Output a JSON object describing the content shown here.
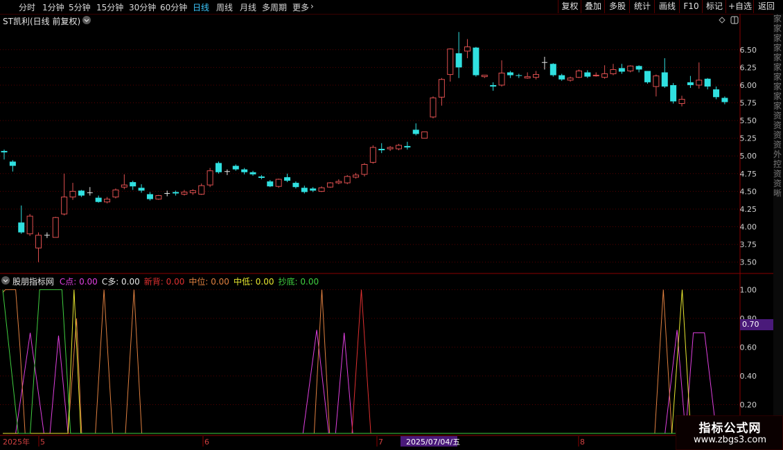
{
  "toolbar": {
    "tabs": [
      "分时",
      "1分钟",
      "5分钟",
      "15分钟",
      "30分钟",
      "60分钟",
      "日线",
      "周线",
      "月线",
      "多周期",
      "更多"
    ],
    "active_tab": "日线",
    "right_buttons": [
      "复权",
      "叠加",
      "多股",
      "统计",
      "画线",
      "F10",
      "标记",
      "+自选",
      "返回"
    ]
  },
  "stock": {
    "title": "ST凯利(日线 前复权)"
  },
  "indicator": {
    "name": "股朋指标网",
    "series": [
      {
        "label": "C点: 0.00",
        "color": "#e040e0"
      },
      {
        "label": "C多: 0.00",
        "color": "#e6e6e6"
      },
      {
        "label": "新背: 0.00",
        "color": "#e03030"
      },
      {
        "label": "中位: 0.00",
        "color": "#e08040"
      },
      {
        "label": "中低: 0.00",
        "color": "#e8e830"
      },
      {
        "label": "抄底: 0.00",
        "color": "#40d040"
      }
    ],
    "current_value": "0.70"
  },
  "right_strip_text": "家家家家家家家家家家资资资资外控资资晰",
  "watermark": {
    "main": "指标公式网",
    "sub": "www.zbgs3.com"
  },
  "date_axis": {
    "labels": [
      "2025年",
      "5",
      "6",
      "7",
      "2025/07/04/五",
      "8"
    ]
  },
  "chart_data": [
    {
      "type": "candlestick",
      "title": "ST凯利(日线 前复权)",
      "y_ticks": [
        3.5,
        3.75,
        4.0,
        4.25,
        4.5,
        4.75,
        5.0,
        5.25,
        5.5,
        5.75,
        6.0,
        6.25,
        6.5
      ],
      "ylim": [
        3.35,
        6.85
      ],
      "grid": true,
      "up_color": "#e05050",
      "down_color": "#30e0e0",
      "candles": [
        [
          5.07,
          5.05,
          4.95,
          5.09
        ],
        [
          4.92,
          4.86,
          4.78,
          4.94
        ],
        [
          4.06,
          3.92,
          3.9,
          4.3
        ],
        [
          3.9,
          4.15,
          3.87,
          4.18
        ],
        [
          3.7,
          3.88,
          3.5,
          3.92
        ],
        [
          3.88,
          3.88,
          3.84,
          3.92
        ],
        [
          3.85,
          4.13,
          3.85,
          4.14
        ],
        [
          4.18,
          4.42,
          4.16,
          4.75
        ],
        [
          4.42,
          4.5,
          4.38,
          4.62
        ],
        [
          4.51,
          4.44,
          4.42,
          4.52
        ],
        [
          4.48,
          4.48,
          4.44,
          4.56
        ],
        [
          4.41,
          4.35,
          4.34,
          4.44
        ],
        [
          4.35,
          4.39,
          4.33,
          4.42
        ],
        [
          4.42,
          4.52,
          4.4,
          4.54
        ],
        [
          4.56,
          4.59,
          4.53,
          4.74
        ],
        [
          4.63,
          4.57,
          4.52,
          4.65
        ],
        [
          4.55,
          4.51,
          4.48,
          4.6
        ],
        [
          4.46,
          4.39,
          4.37,
          4.49
        ],
        [
          4.39,
          4.44,
          4.38,
          4.45
        ],
        [
          4.47,
          4.47,
          4.43,
          4.51
        ],
        [
          4.49,
          4.47,
          4.44,
          4.51
        ],
        [
          4.46,
          4.49,
          4.44,
          4.52
        ],
        [
          4.48,
          4.51,
          4.45,
          4.53
        ],
        [
          4.46,
          4.58,
          4.45,
          4.61
        ],
        [
          4.59,
          4.79,
          4.56,
          4.83
        ],
        [
          4.9,
          4.77,
          4.75,
          4.92
        ],
        [
          4.78,
          4.78,
          4.73,
          4.81
        ],
        [
          4.86,
          4.81,
          4.79,
          4.88
        ],
        [
          4.81,
          4.77,
          4.74,
          4.83
        ],
        [
          4.77,
          4.74,
          4.72,
          4.79
        ],
        [
          4.71,
          4.69,
          4.67,
          4.73
        ],
        [
          4.64,
          4.57,
          4.56,
          4.66
        ],
        [
          4.57,
          4.67,
          4.55,
          4.68
        ],
        [
          4.7,
          4.65,
          4.63,
          4.75
        ],
        [
          4.62,
          4.56,
          4.54,
          4.64
        ],
        [
          4.55,
          4.49,
          4.47,
          4.58
        ],
        [
          4.54,
          4.51,
          4.49,
          4.56
        ],
        [
          4.5,
          4.55,
          4.49,
          4.57
        ],
        [
          4.56,
          4.62,
          4.55,
          4.63
        ],
        [
          4.62,
          4.64,
          4.6,
          4.67
        ],
        [
          4.62,
          4.71,
          4.6,
          4.73
        ],
        [
          4.7,
          4.73,
          4.68,
          4.76
        ],
        [
          4.74,
          4.88,
          4.71,
          4.9
        ],
        [
          4.91,
          5.12,
          4.89,
          5.15
        ],
        [
          5.1,
          5.08,
          5.04,
          5.18
        ],
        [
          5.1,
          5.12,
          5.07,
          5.14
        ],
        [
          5.1,
          5.15,
          5.08,
          5.17
        ],
        [
          5.14,
          5.12,
          5.09,
          5.2
        ],
        [
          5.37,
          5.31,
          5.29,
          5.46
        ],
        [
          5.25,
          5.34,
          5.25,
          5.34
        ],
        [
          5.55,
          5.82,
          5.53,
          5.84
        ],
        [
          5.83,
          6.08,
          5.71,
          6.1
        ],
        [
          6.15,
          6.51,
          6.05,
          6.52
        ],
        [
          6.45,
          6.25,
          6.1,
          6.75
        ],
        [
          6.48,
          6.54,
          6.38,
          6.65
        ],
        [
          6.53,
          6.14,
          6.12,
          6.54
        ],
        [
          6.12,
          6.14,
          6.1,
          6.14
        ],
        [
          6.0,
          5.98,
          5.92,
          6.04
        ],
        [
          6.0,
          6.17,
          5.98,
          6.35
        ],
        [
          6.18,
          6.14,
          6.1,
          6.2
        ],
        [
          6.14,
          6.13,
          6.1,
          6.16
        ],
        [
          6.1,
          6.12,
          6.09,
          6.18
        ],
        [
          6.11,
          6.15,
          6.08,
          6.2
        ],
        [
          6.32,
          6.32,
          6.22,
          6.4
        ],
        [
          6.3,
          6.14,
          6.12,
          6.31
        ],
        [
          6.14,
          6.08,
          6.06,
          6.16
        ],
        [
          6.07,
          6.1,
          6.05,
          6.12
        ],
        [
          6.11,
          6.2,
          6.1,
          6.22
        ],
        [
          6.18,
          6.12,
          6.1,
          6.21
        ],
        [
          6.13,
          6.14,
          6.12,
          6.18
        ],
        [
          6.11,
          6.16,
          6.09,
          6.28
        ],
        [
          6.16,
          6.22,
          6.14,
          6.3
        ],
        [
          6.24,
          6.19,
          6.16,
          6.3
        ],
        [
          6.2,
          6.27,
          6.18,
          6.28
        ],
        [
          6.27,
          6.22,
          6.18,
          6.28
        ],
        [
          6.2,
          6.04,
          6.02,
          6.2
        ],
        [
          5.98,
          6.13,
          5.84,
          6.15
        ],
        [
          6.18,
          5.98,
          5.96,
          6.38
        ],
        [
          6.0,
          5.77,
          5.74,
          6.03
        ],
        [
          5.74,
          5.8,
          5.7,
          5.85
        ],
        [
          6.04,
          6.0,
          5.96,
          6.13
        ],
        [
          6.0,
          6.07,
          5.95,
          6.32
        ],
        [
          6.09,
          5.98,
          5.94,
          6.1
        ],
        [
          5.94,
          5.83,
          5.8,
          5.98
        ],
        [
          5.82,
          5.76,
          5.73,
          5.84
        ]
      ]
    },
    {
      "type": "line",
      "title": "股朋指标网",
      "y_ticks": [
        0.2,
        0.4,
        0.6,
        0.8,
        1.0
      ],
      "ylim": [
        0.0,
        1.05
      ],
      "series": [
        {
          "name": "C点",
          "color": "#e040e0",
          "points": [
            [
              0,
              0
            ],
            [
              1.5,
              0
            ],
            [
              3.2,
              0.7
            ],
            [
              4.8,
              0
            ],
            [
              5.5,
              0
            ],
            [
              6.5,
              0.68
            ],
            [
              7.6,
              0
            ],
            [
              35.0,
              0
            ],
            [
              36.6,
              0.72
            ],
            [
              38.0,
              0
            ],
            [
              38.8,
              0
            ],
            [
              39.8,
              0.7
            ],
            [
              40.8,
              0
            ],
            [
              77.2,
              0
            ],
            [
              78.6,
              0.72
            ],
            [
              79.6,
              0
            ],
            [
              80.5,
              0.7
            ],
            [
              81.8,
              0.7
            ],
            [
              83.2,
              0
            ],
            [
              86,
              0
            ]
          ]
        },
        {
          "name": "新背",
          "color": "#e03030",
          "points": [
            [
              0,
              0
            ],
            [
              40.7,
              0
            ],
            [
              41.8,
              1.0
            ],
            [
              42.9,
              0
            ],
            [
              86,
              0
            ]
          ]
        },
        {
          "name": "中位",
          "color": "#e08040",
          "points": [
            [
              0,
              0.98
            ],
            [
              0.3,
              1.0
            ],
            [
              1.5,
              1.0
            ],
            [
              2.0,
              0.6
            ],
            [
              2.6,
              0
            ],
            [
              7.6,
              0
            ],
            [
              8.6,
              0.8
            ],
            [
              9.2,
              0
            ],
            [
              10.0,
              0
            ],
            [
              10.8,
              0
            ],
            [
              11.8,
              1.0
            ],
            [
              12.8,
              0
            ],
            [
              14.3,
              0
            ],
            [
              15.3,
              1.0
            ],
            [
              16.2,
              0
            ],
            [
              36.3,
              0
            ],
            [
              37.2,
              1.0
            ],
            [
              38.1,
              0
            ],
            [
              76.0,
              0
            ],
            [
              77.0,
              1.0
            ],
            [
              78.0,
              0
            ],
            [
              86,
              0
            ]
          ]
        },
        {
          "name": "中低",
          "color": "#e8e830",
          "points": [
            [
              0,
              0
            ],
            [
              7.6,
              0
            ],
            [
              8.3,
              1.0
            ],
            [
              9.1,
              0
            ],
            [
              86,
              0
            ],
            [
              78.0,
              0
            ],
            [
              79.2,
              1.0
            ],
            [
              80.2,
              0
            ]
          ]
        },
        {
          "name": "抄底",
          "color": "#40d040",
          "points": [
            [
              0,
              1.0
            ],
            [
              1.8,
              0
            ],
            [
              3.2,
              0
            ],
            [
              4.3,
              1.0
            ],
            [
              6.9,
              1.0
            ],
            [
              7.9,
              0
            ],
            [
              86,
              0
            ]
          ]
        }
      ]
    }
  ]
}
